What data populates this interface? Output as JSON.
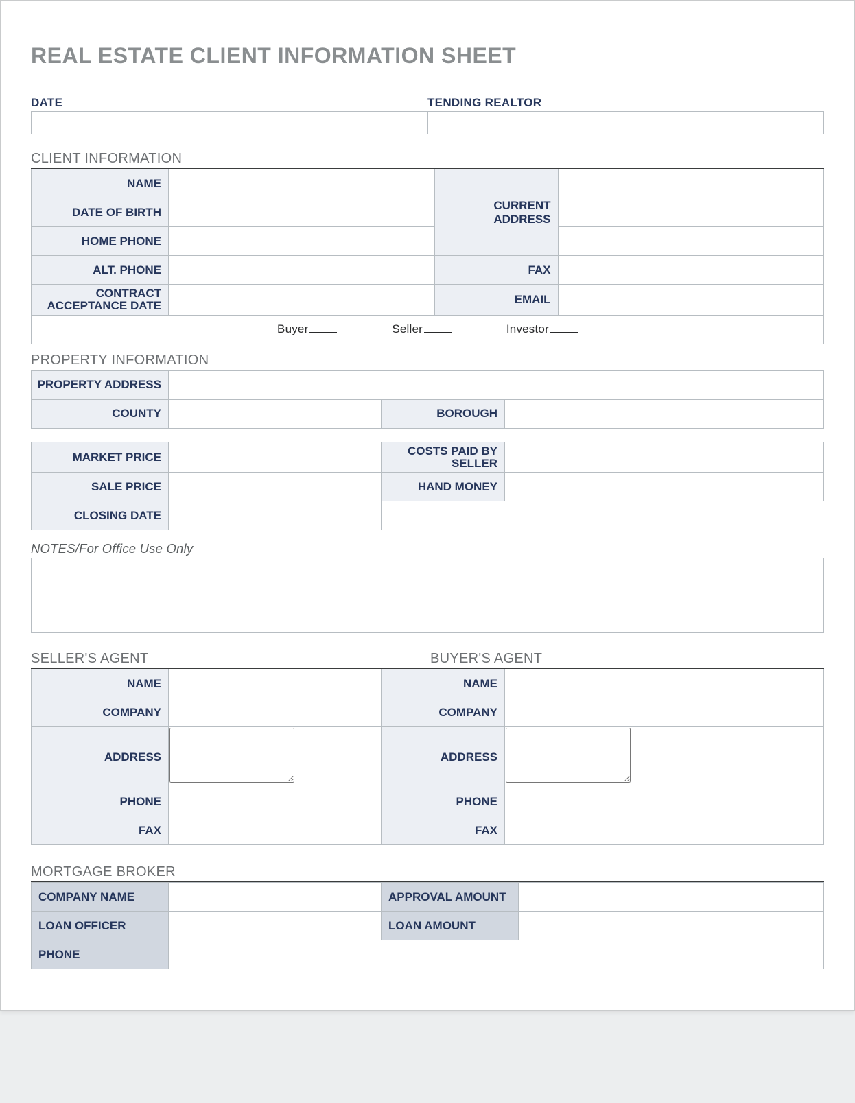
{
  "title": "REAL ESTATE CLIENT INFORMATION SHEET",
  "top": {
    "date_label": "DATE",
    "realtor_label": "TENDING REALTOR"
  },
  "client": {
    "header": "CLIENT INFORMATION",
    "name": "NAME",
    "dob": "DATE OF BIRTH",
    "home_phone": "HOME PHONE",
    "alt_phone": "ALT. PHONE",
    "contract_date": "CONTRACT ACCEPTANCE DATE",
    "current_address": "CURRENT ADDRESS",
    "fax": "FAX",
    "email": "EMAIL",
    "choice_buyer": "Buyer",
    "choice_seller": "Seller",
    "choice_investor": "Investor"
  },
  "property": {
    "header": "PROPERTY INFORMATION",
    "address": "PROPERTY ADDRESS",
    "county": "COUNTY",
    "borough": "BOROUGH",
    "market_price": "MARKET PRICE",
    "sale_price": "SALE PRICE",
    "closing_date": "CLOSING DATE",
    "costs_paid": "COSTS PAID BY SELLER",
    "hand_money": "HAND MONEY"
  },
  "notes_label": "NOTES/For Office Use Only",
  "agents": {
    "seller_header": "SELLER'S AGENT",
    "buyer_header": "BUYER'S AGENT",
    "name": "NAME",
    "company": "COMPANY",
    "address": "ADDRESS",
    "phone": "PHONE",
    "fax": "FAX"
  },
  "broker": {
    "header": "MORTGAGE BROKER",
    "company_name": "COMPANY NAME",
    "loan_officer": "LOAN OFFICER",
    "phone": "PHONE",
    "approval_amount": "APPROVAL AMOUNT",
    "loan_amount": "LOAN AMOUNT"
  }
}
